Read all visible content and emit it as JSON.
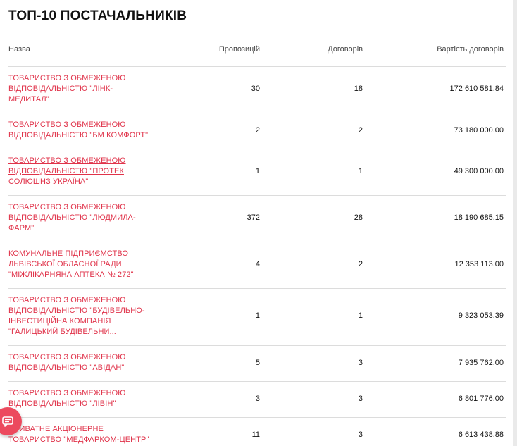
{
  "title": "ТОП-10 ПОСТАЧАЛЬНИКІВ",
  "columns": {
    "name": "Назва",
    "proposals": "Пропозицій",
    "contracts": "Договорів",
    "value": "Вартість договорів"
  },
  "rows": [
    {
      "name": "ТОВАРИСТВО З ОБМЕЖЕНОЮ ВІДПОВІДАЛЬНІСТЮ \"ЛІНК-МЕДИТАЛ\"",
      "proposals": "30",
      "contracts": "18",
      "value": "172 610 581.84"
    },
    {
      "name": "ТОВАРИСТВО З ОБМЕЖЕНОЮ ВІДПОВІДАЛЬНІСТЮ \"БМ КОМФОРТ\"",
      "proposals": "2",
      "contracts": "2",
      "value": "73 180 000.00"
    },
    {
      "name": "ТОВАРИСТВО З ОБМЕЖЕНОЮ ВІДПОВІДАЛЬНІСТЮ \"ПРОТЕК СОЛЮШНЗ УКРАЇНА\"",
      "proposals": "1",
      "contracts": "1",
      "value": "49 300 000.00"
    },
    {
      "name": "ТОВАРИСТВО З ОБМЕЖЕНОЮ ВІДПОВІДАЛЬНІСТЮ \"ЛЮДМИЛА-ФАРМ\"",
      "proposals": "372",
      "contracts": "28",
      "value": "18 190 685.15"
    },
    {
      "name": "КОМУНАЛЬНЕ ПІДПРИЄМСТВО ЛЬВІВСЬКОЇ ОБЛАСНОЇ РАДИ \"МІЖЛІКАРНЯНА АПТЕКА № 272\"",
      "proposals": "4",
      "contracts": "2",
      "value": "12 353 113.00"
    },
    {
      "name": "ТОВАРИСТВО З ОБМЕЖЕНОЮ ВІДПОВІДАЛЬНІСТЮ \"БУДІВЕЛЬНО-ІНВЕСТИЦІЙНА КОМПАНІЯ \"ГАЛИЦЬКИЙ БУДІВЕЛЬНИ...",
      "proposals": "1",
      "contracts": "1",
      "value": "9 323 053.39"
    },
    {
      "name": "ТОВАРИСТВО З ОБМЕЖЕНОЮ ВІДПОВІДАЛЬНІСТЮ \"АВІДАН\"",
      "proposals": "5",
      "contracts": "3",
      "value": "7 935 762.00"
    },
    {
      "name": "ТОВАРИСТВО З ОБМЕЖЕНОЮ ВІДПОВІДАЛЬНІСТЮ \"ЛІВІН\"",
      "proposals": "3",
      "contracts": "3",
      "value": "6 801 776.00"
    },
    {
      "name": "ПРИВАТНЕ АКЦІОНЕРНЕ ТОВАРИСТВО \"МЕДФАРКОМ-ЦЕНТР\"",
      "proposals": "11",
      "contracts": "3",
      "value": "6 613 438.88"
    }
  ],
  "chat_button": {
    "icon": "chat-icon",
    "color": "#ec4a5e"
  },
  "colors": {
    "link": "#e0334a",
    "accent": "#ec4a5e"
  }
}
